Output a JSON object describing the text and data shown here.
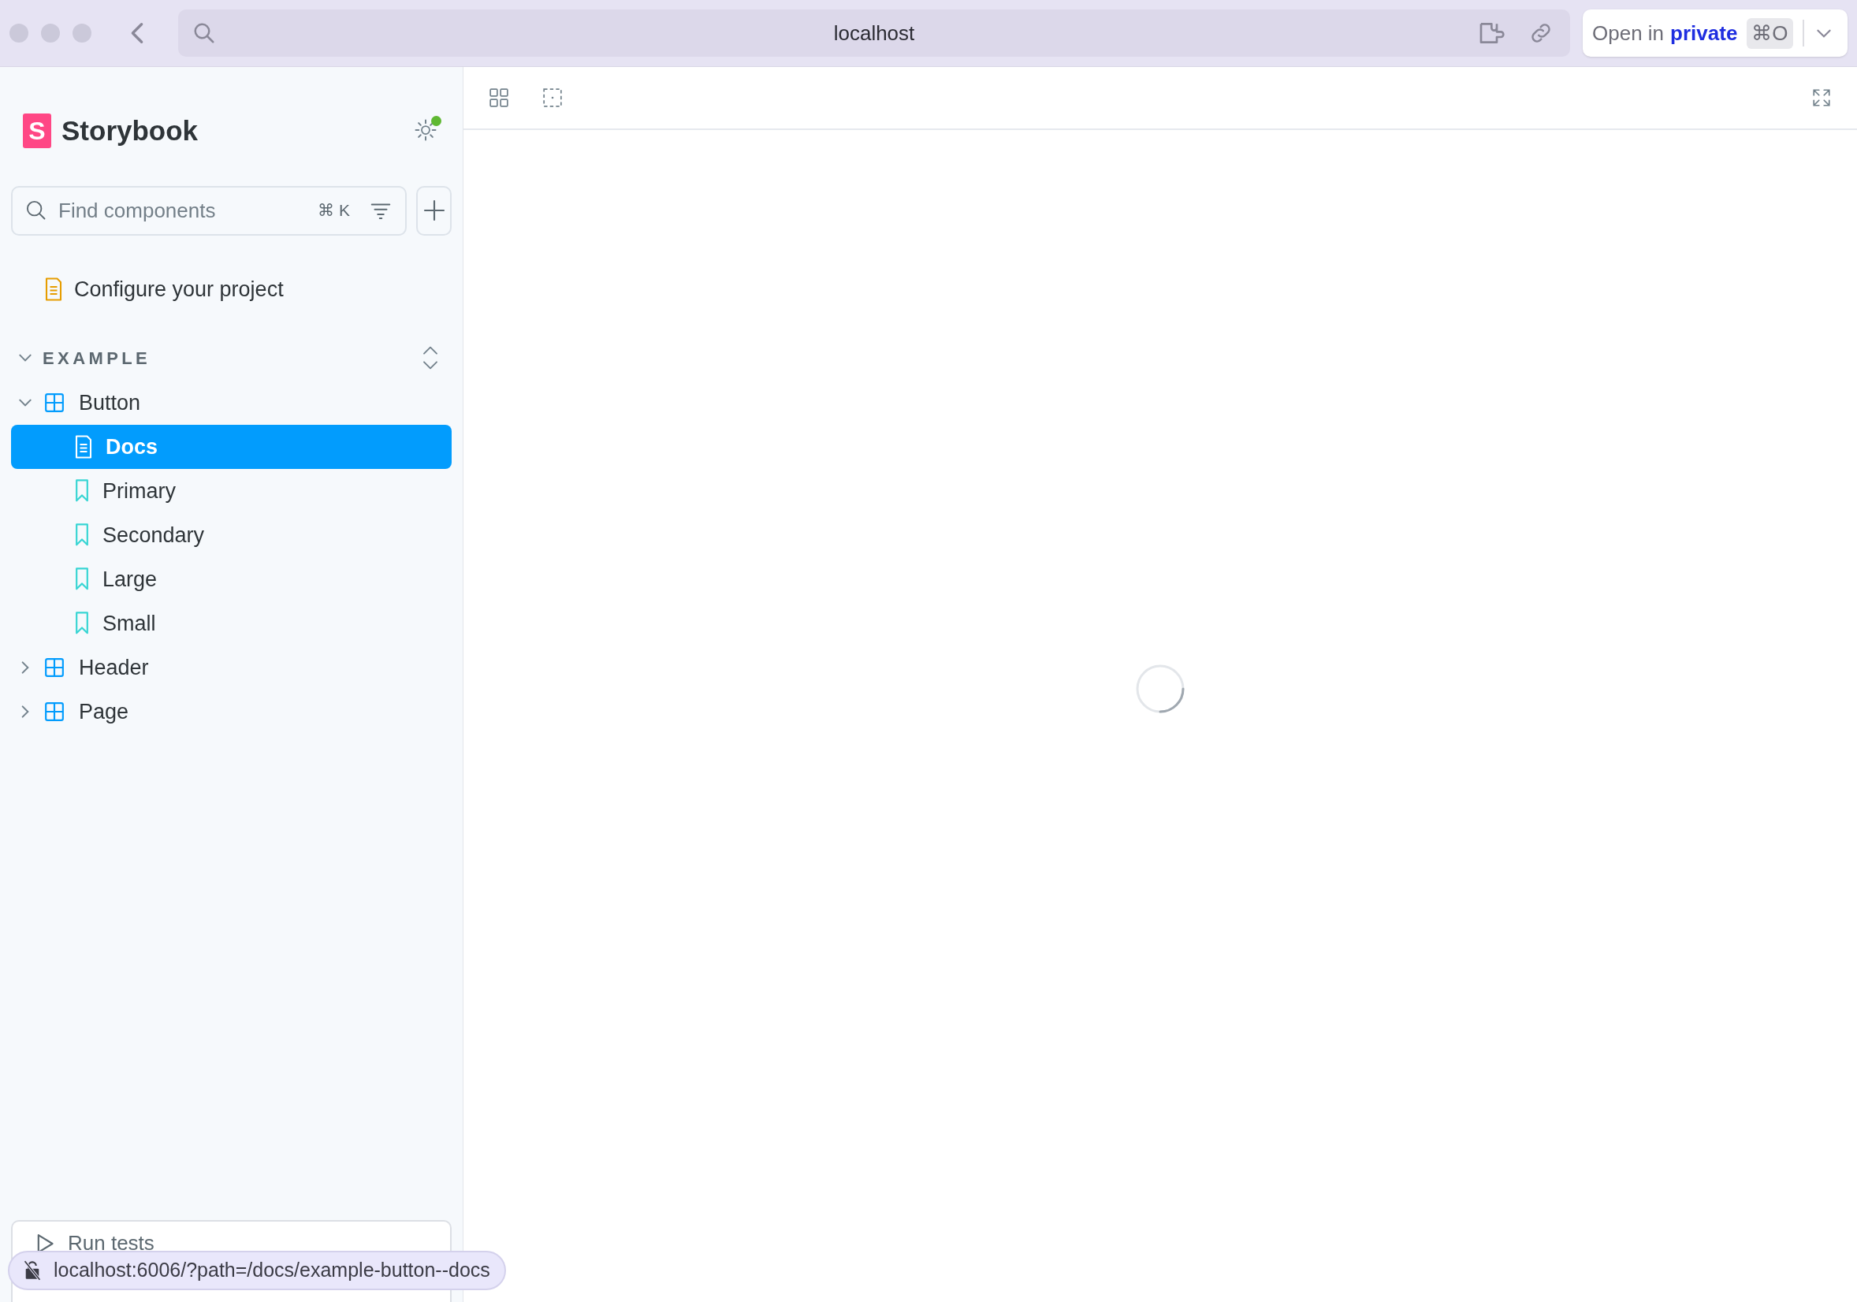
{
  "browser": {
    "address": "localhost",
    "open_button": {
      "label": "Open in",
      "highlight": "private",
      "shortcut": "⌘O"
    }
  },
  "sidebar": {
    "logo_letter": "S",
    "brand": "Storybook",
    "settings_badge": true,
    "search": {
      "placeholder": "Find components",
      "shortcut": "⌘ K"
    },
    "items": [
      {
        "kind": "doc",
        "label": "Configure your project",
        "selected": false
      }
    ],
    "sections": [
      {
        "label": "EXAMPLE",
        "expanded": true,
        "components": [
          {
            "label": "Button",
            "expanded": true,
            "children": [
              {
                "kind": "docs",
                "label": "Docs",
                "selected": true
              },
              {
                "kind": "story",
                "label": "Primary",
                "selected": false
              },
              {
                "kind": "story",
                "label": "Secondary",
                "selected": false
              },
              {
                "kind": "story",
                "label": "Large",
                "selected": false
              },
              {
                "kind": "story",
                "label": "Small",
                "selected": false
              }
            ]
          },
          {
            "label": "Header",
            "expanded": false
          },
          {
            "label": "Page",
            "expanded": false
          }
        ]
      }
    ],
    "run_tests": "Run tests"
  },
  "status_url": "localhost:6006/?path=/docs/example-button--docs"
}
